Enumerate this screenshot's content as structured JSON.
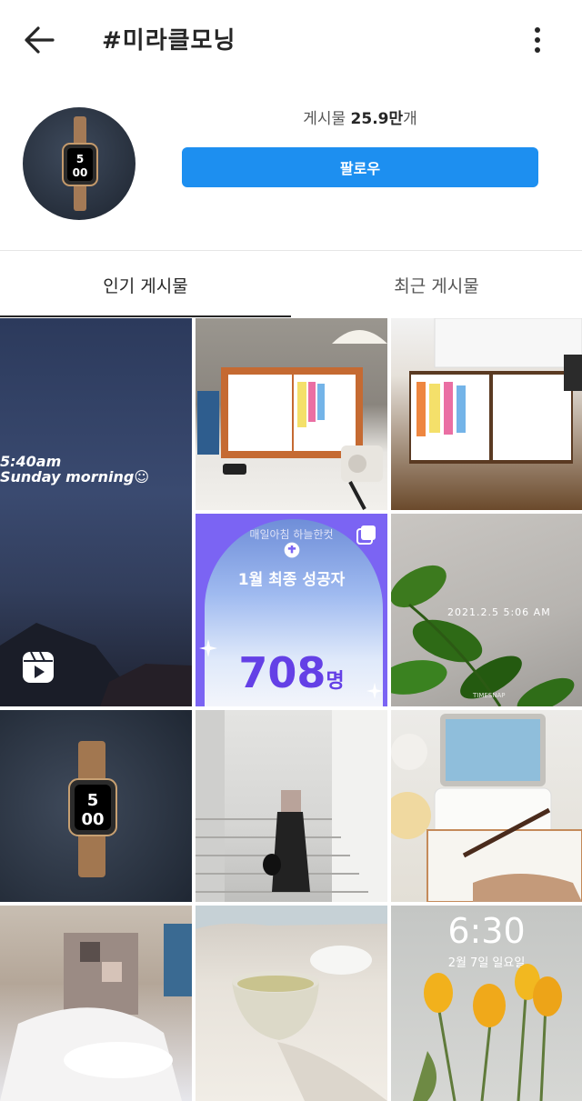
{
  "header": {
    "title": "#미라클모닝"
  },
  "profile": {
    "posts_label": "게시물",
    "posts_count": "25.9만",
    "posts_unit": "개",
    "follow_label": "팔로우"
  },
  "tabs": [
    {
      "label": "인기 게시물"
    },
    {
      "label": "최근 게시물"
    }
  ],
  "grid": {
    "reel_text_line1": "5:40am",
    "reel_text_line2": "Sunday morning☺",
    "challenge_subtitle": "매일아침 하늘한컷",
    "challenge_title": "1월 최종 성공자",
    "challenge_count": "708",
    "challenge_unit": "명",
    "plant_timestamp": "2021.2.5 5:06 AM",
    "plant_watermark": "TIMESNAP",
    "lock_time": "6:30",
    "lock_date": "2월 7일 일요일"
  },
  "colors": {
    "accent": "#1d8ff0",
    "text": "#262626"
  }
}
